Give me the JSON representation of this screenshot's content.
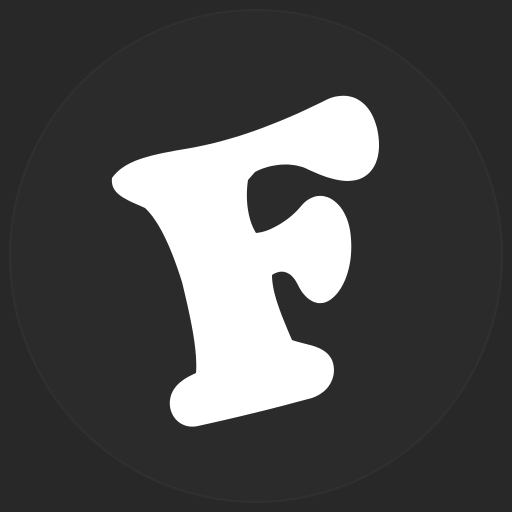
{
  "app_icon": {
    "icon": "letter-f-logo-icon",
    "logo_text": "F",
    "colors": {
      "background": "#282828",
      "circle": "#2b2b2b",
      "circle_edge": "#303030",
      "glyph": "#ffffff"
    }
  }
}
